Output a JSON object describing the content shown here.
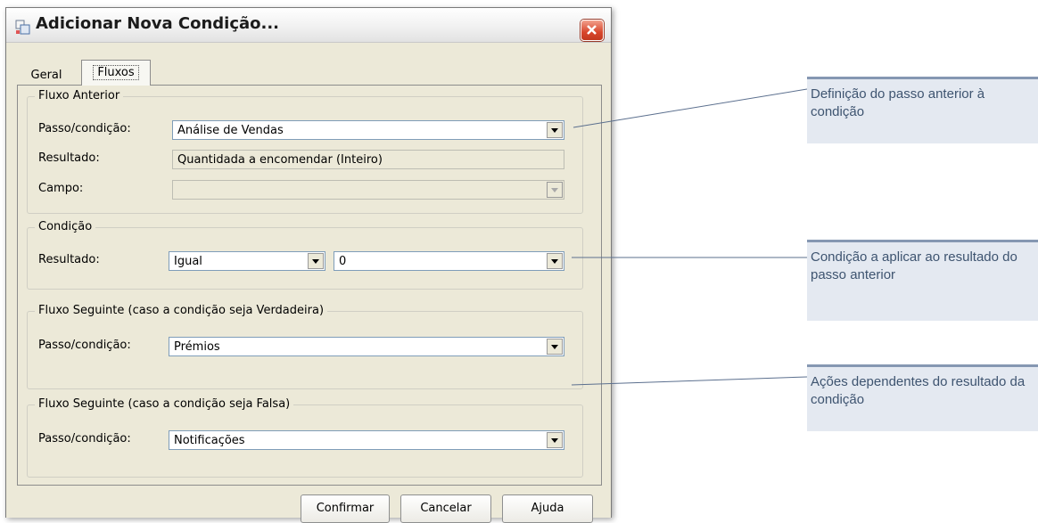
{
  "window": {
    "title": "Adicionar Nova Condição..."
  },
  "tabs": [
    {
      "label": "Geral"
    },
    {
      "label": "Fluxos"
    }
  ],
  "fluxo_anterior": {
    "legend": "Fluxo Anterior",
    "passo_label": "Passo/condição:",
    "passo_value": "Análise de Vendas",
    "resultado_label": "Resultado:",
    "resultado_value": "Quantidada a encomendar (Inteiro)",
    "campo_label": "Campo:",
    "campo_value": ""
  },
  "condicao": {
    "legend": "Condição",
    "resultado_label": "Resultado:",
    "operator_value": "Igual",
    "operand_value": "0"
  },
  "fluxo_verdadeira": {
    "legend": "Fluxo Seguinte (caso a condição seja Verdadeira)",
    "passo_label": "Passo/condição:",
    "passo_value": "Prémios"
  },
  "fluxo_falsa": {
    "legend": "Fluxo Seguinte (caso a condição seja Falsa)",
    "passo_label": "Passo/condição:",
    "passo_value": "Notificações"
  },
  "buttons": {
    "confirm": "Confirmar",
    "cancel": "Cancelar",
    "help": "Ajuda"
  },
  "annotations": [
    {
      "text": "Definição do passo anterior à condição"
    },
    {
      "text": "Condição a aplicar ao resultado do passo anterior"
    },
    {
      "text": "Ações dependentes do resultado da condição"
    }
  ],
  "colors": {
    "callout_bg": "#e4e9f1",
    "callout_text": "#3e5470",
    "close_button": "#d8462c"
  }
}
